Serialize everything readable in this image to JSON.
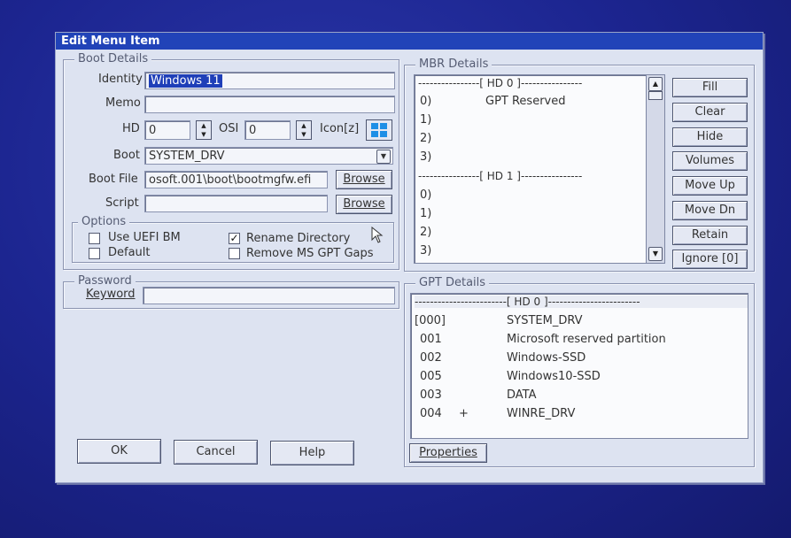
{
  "window": {
    "title": "Edit Menu Item"
  },
  "boot_details": {
    "group_label": "Boot Details",
    "identity_label": "Identity",
    "identity_value": "Windows 11",
    "memo_label": "Memo",
    "memo_value": "",
    "hd_label": "HD",
    "hd_value": "0",
    "osi_label": "OSI",
    "osi_value": "0",
    "icon_label": "Icon[z]",
    "boot_label": "Boot",
    "boot_value": "SYSTEM_DRV",
    "boot_file_label": "Boot File",
    "boot_file_value": "osoft.001\\boot\\bootmgfw.efi",
    "browse_label": "Browse",
    "script_label": "Script",
    "script_value": "",
    "script_browse_label": "Browse"
  },
  "options": {
    "group_label": "Options",
    "items": [
      {
        "label": "Use UEFI BM",
        "checked": false
      },
      {
        "label": "Default",
        "checked": false
      },
      {
        "label": "Rename Directory",
        "checked": true
      },
      {
        "label": "Remove MS GPT Gaps",
        "checked": false
      }
    ]
  },
  "password": {
    "group_label": "Password",
    "keyword_label": "Keyword",
    "keyword_value": ""
  },
  "dialog_buttons": {
    "ok": "OK",
    "cancel": "Cancel",
    "help": "Help"
  },
  "mbr_details": {
    "group_label": "MBR Details",
    "lines": [
      "----------------[ HD 0 ]----------------",
      "0)",
      "1)",
      "2)",
      "3)",
      "----------------[ HD 1 ]----------------",
      "0)",
      "1)",
      "2)",
      "3)"
    ],
    "line0_entry": "GPT Reserved",
    "buttons": [
      "Fill",
      "Clear",
      "Hide",
      "Volumes",
      "Move Up",
      "Move Dn",
      "Retain",
      "Ignore [0]"
    ]
  },
  "gpt_details": {
    "group_label": "GPT Details",
    "header": "------------------------[ HD 0 ]------------------------",
    "rows": [
      {
        "num": "[000]",
        "flag": "",
        "name": "SYSTEM_DRV"
      },
      {
        "num": "001",
        "flag": "",
        "name": "Microsoft reserved partition"
      },
      {
        "num": "002",
        "flag": "",
        "name": "Windows-SSD"
      },
      {
        "num": "005",
        "flag": "",
        "name": "Windows10-SSD"
      },
      {
        "num": "003",
        "flag": "",
        "name": "DATA"
      },
      {
        "num": "004",
        "flag": "+",
        "name": "WINRE_DRV"
      }
    ],
    "properties_label": "Properties"
  },
  "colors": {
    "titlebar": "#2143b8",
    "window": "#dde3f1",
    "selection": "#1f3fb8",
    "windows_icon": "#1e8fe6"
  }
}
